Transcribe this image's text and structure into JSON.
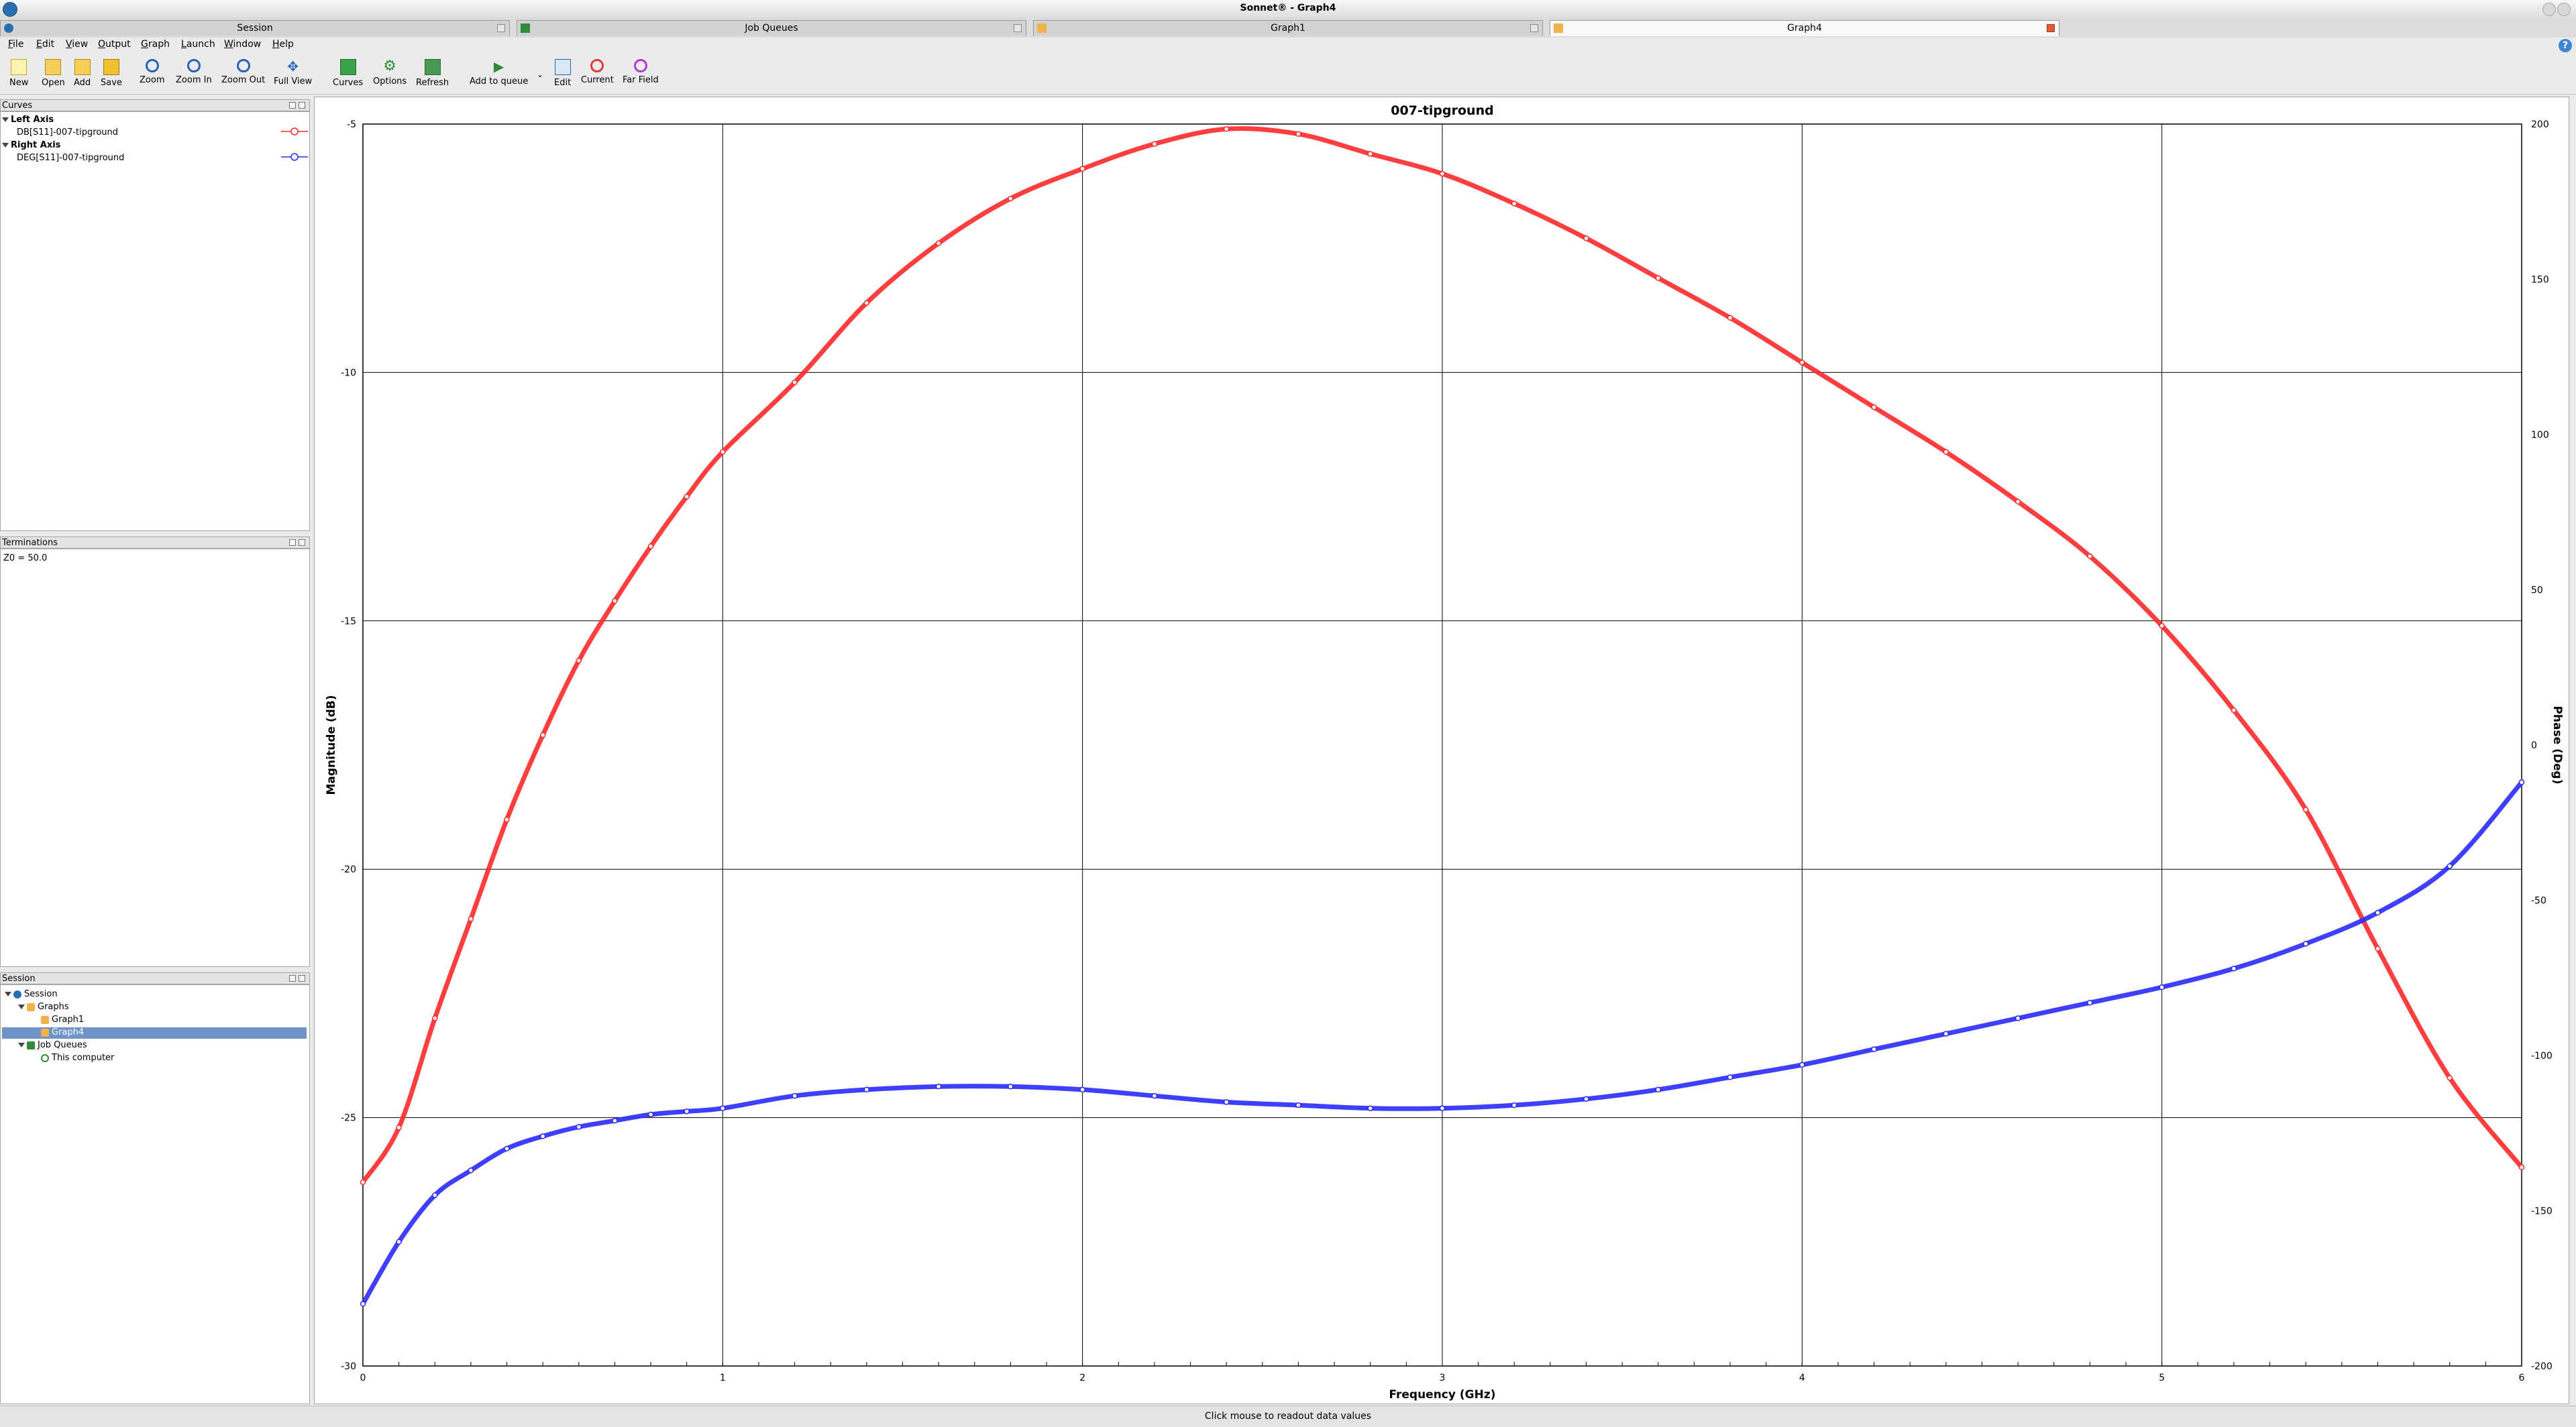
{
  "window": {
    "title": "Sonnet® - Graph4"
  },
  "tabs": [
    {
      "label": "Session",
      "active": false
    },
    {
      "label": "Job Queues",
      "active": false
    },
    {
      "label": "Graph1",
      "active": false
    },
    {
      "label": "Graph4",
      "active": true
    }
  ],
  "menu": [
    "File",
    "Edit",
    "View",
    "Output",
    "Graph",
    "Launch",
    "Window",
    "Help"
  ],
  "toolbar": {
    "new": "New",
    "open": "Open",
    "add": "Add",
    "save": "Save",
    "zoom": "Zoom",
    "zoom_in": "Zoom In",
    "zoom_out": "Zoom Out",
    "full_view": "Full View",
    "curves": "Curves",
    "options": "Options",
    "refresh": "Refresh",
    "add_to_queue": "Add to queue",
    "edit": "Edit",
    "current": "Current",
    "far_field": "Far Field"
  },
  "panels": {
    "curves": {
      "title": "Curves",
      "left_axis": "Left Axis",
      "left_curve": "DB[S11]-007-tipground",
      "right_axis": "Right Axis",
      "right_curve": "DEG[S11]-007-tipground"
    },
    "terminations": {
      "title": "Terminations",
      "text": "Z0 = 50.0"
    },
    "session": {
      "title": "Session",
      "root": "Session",
      "graphs": "Graphs",
      "graph1": "Graph1",
      "graph4": "Graph4",
      "job_queues": "Job Queues",
      "this_computer": "This computer"
    }
  },
  "status": {
    "text": "Click mouse to readout data values"
  },
  "colors": {
    "mag": "#ff2a2a",
    "phase": "#2a2aff",
    "selected": "#6f93c7"
  },
  "chart_data": {
    "type": "line",
    "title": "007-tipground",
    "xlabel": "Frequency (GHz)",
    "ylabel": "Magnitude (dB)",
    "y2label": "Phase (Deg)",
    "xlim": [
      0,
      6
    ],
    "ylim": [
      -30,
      -5
    ],
    "y2lim": [
      -200,
      200
    ],
    "xticks": [
      0,
      1,
      2,
      3,
      4,
      5,
      6
    ],
    "yticks": [
      -5,
      -10,
      -15,
      -20,
      -25,
      -30
    ],
    "y2ticks": [
      200,
      150,
      100,
      50,
      0,
      -50,
      -100,
      -150,
      -200
    ],
    "grid": true,
    "series": [
      {
        "name": "DB[S11]-007-tipground",
        "axis": "left",
        "x": [
          0,
          0.1,
          0.2,
          0.3,
          0.4,
          0.5,
          0.6,
          0.7,
          0.8,
          0.9,
          1.0,
          1.2,
          1.4,
          1.6,
          1.8,
          2.0,
          2.2,
          2.4,
          2.6,
          2.8,
          3.0,
          3.2,
          3.4,
          3.6,
          3.8,
          4.0,
          4.2,
          4.4,
          4.6,
          4.8,
          5.0,
          5.2,
          5.4,
          5.6,
          5.8,
          6.0
        ],
        "y": [
          -26.3,
          -25.2,
          -23.0,
          -21.0,
          -19.0,
          -17.3,
          -15.8,
          -14.6,
          -13.5,
          -12.5,
          -11.6,
          -10.2,
          -8.6,
          -7.4,
          -6.5,
          -5.9,
          -5.4,
          -5.1,
          -5.2,
          -5.6,
          -6.0,
          -6.6,
          -7.3,
          -8.1,
          -8.9,
          -9.8,
          -10.7,
          -11.6,
          -12.6,
          -13.7,
          -15.1,
          -16.8,
          -18.8,
          -21.6,
          -24.2,
          -26.0
        ]
      },
      {
        "name": "DEG[S11]-007-tipground",
        "axis": "right",
        "x": [
          0,
          0.1,
          0.2,
          0.3,
          0.4,
          0.5,
          0.6,
          0.7,
          0.8,
          0.9,
          1.0,
          1.2,
          1.4,
          1.6,
          1.8,
          2.0,
          2.2,
          2.4,
          2.6,
          2.8,
          3.0,
          3.2,
          3.4,
          3.6,
          3.8,
          4.0,
          4.2,
          4.4,
          4.6,
          4.8,
          5.0,
          5.2,
          5.4,
          5.6,
          5.8,
          6.0
        ],
        "y": [
          -180,
          -160,
          -145,
          -137,
          -130,
          -126,
          -123,
          -121,
          -119,
          -118,
          -117,
          -113,
          -111,
          -110,
          -110,
          -111,
          -113,
          -115,
          -116,
          -117,
          -117,
          -116,
          -114,
          -111,
          -107,
          -103,
          -98,
          -93,
          -88,
          -83,
          -78,
          -72,
          -64,
          -54,
          -39,
          -12
        ]
      }
    ]
  }
}
